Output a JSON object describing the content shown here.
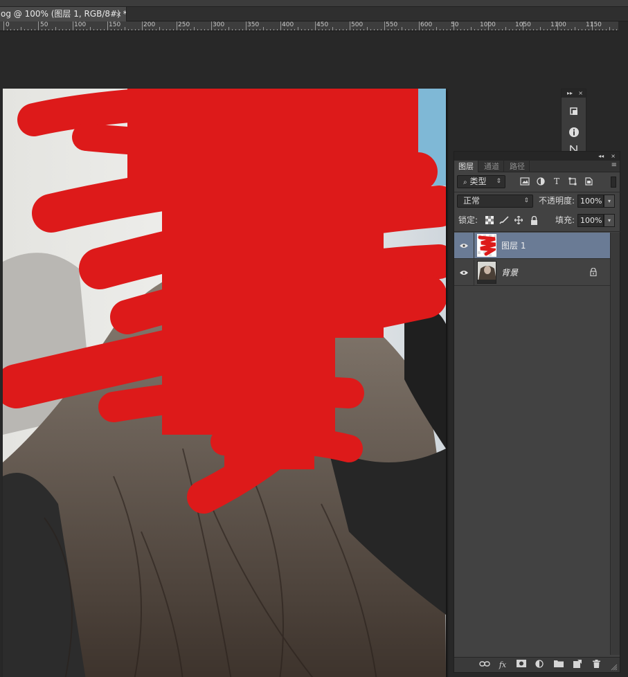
{
  "document": {
    "tab_title": "og @ 100% (图层 1, RGB/8#) *",
    "tab_close": "×"
  },
  "ruler": {
    "labels": [
      "0",
      "50",
      "100",
      "150",
      "200",
      "250",
      "300",
      "350",
      "400",
      "450",
      "500",
      "550",
      "600",
      "50",
      "1000",
      "1050",
      "1100",
      "1150"
    ]
  },
  "mini_panel": {
    "header": "▸▸",
    "close": "×",
    "icons": [
      "3d-icon",
      "info-icon",
      "paragraph-icon"
    ]
  },
  "layers_panel": {
    "header_arrows": "◂◂",
    "header_close": "×",
    "tabs": [
      {
        "label": "图层",
        "active": true
      },
      {
        "label": "通道",
        "active": false
      },
      {
        "label": "路径",
        "active": false
      }
    ],
    "menu_icon": "≡",
    "filter_kind": "类型",
    "filter_icons": [
      "image-filter-icon",
      "adjustment-filter-icon",
      "type-filter-icon",
      "shape-filter-icon",
      "smart-object-filter-icon"
    ],
    "type_glyph": "T",
    "blend_mode": "正常",
    "opacity_label": "不透明度:",
    "opacity_value": "100%",
    "lock_label": "锁定:",
    "lock_icons": [
      "lock-transparent-icon",
      "lock-paint-icon",
      "lock-move-icon",
      "lock-all-icon"
    ],
    "fill_label": "填充:",
    "fill_value": "100%",
    "layers": [
      {
        "name": "图层 1",
        "selected": true,
        "visible": true,
        "locked": false
      },
      {
        "name": "背景",
        "selected": false,
        "visible": true,
        "locked": true
      }
    ],
    "footer_icons": [
      "link-layers-icon",
      "fx-icon",
      "mask-icon",
      "adjustment-layer-icon",
      "group-folder-icon",
      "new-layer-icon",
      "delete-icon"
    ],
    "footer_fx": "fx"
  },
  "colors": {
    "scribble_red": "#dd1a1a",
    "selected_layer": "#6a7b95",
    "panel_bg": "#424242",
    "workspace_bg": "#282828"
  }
}
